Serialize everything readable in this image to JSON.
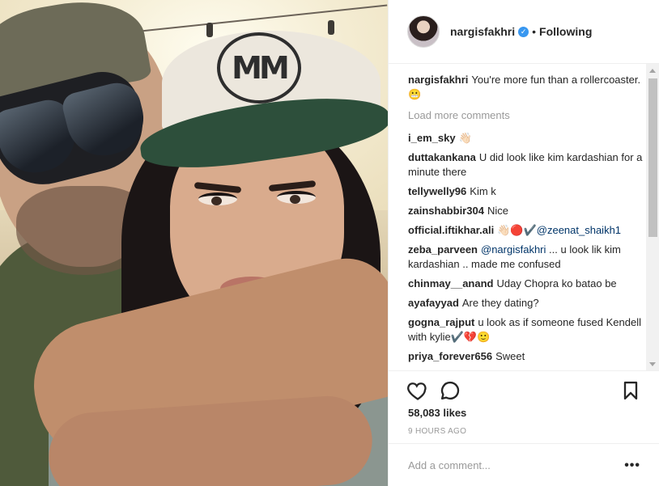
{
  "post": {
    "username": "nargisfakhri",
    "verified": true,
    "follow_separator": "•",
    "follow_status": "Following",
    "caption_user": "nargisfakhri",
    "caption_text": "You're more fun than a rollercoaster. 😬",
    "load_more": "Load more comments",
    "likes": "58,083 likes",
    "time_ago": "9 HOURS AGO",
    "add_comment_placeholder": "Add a comment...",
    "more_label": "•••",
    "photo_cap_logo": "MM"
  },
  "comments": [
    {
      "user": "i_em_sky",
      "text": "👋🏻"
    },
    {
      "user": "duttakankana",
      "text": "U did look like kim kardashian for a minute there"
    },
    {
      "user": "tellywelly96",
      "text": "Kim k"
    },
    {
      "user": "zainshabbir304",
      "text": "Nice"
    },
    {
      "user": "official.iftikhar.ali",
      "text": "👋🏻🔴✔️",
      "mention": "@zeenat_shaikh1"
    },
    {
      "user": "zeba_parveen",
      "mention": "@nargisfakhri",
      "text": "... u look lik kim kardashian .. made me confused"
    },
    {
      "user": "chinmay__anand",
      "text": "Uday Chopra ko batao be"
    },
    {
      "user": "ayafayyad",
      "text": "Are they dating?"
    },
    {
      "user": "gogna_rajput",
      "text": "u look as if someone fused Kendell with kylie✔️💔🙂"
    },
    {
      "user": "priya_forever656",
      "text": "Sweet"
    }
  ],
  "icons": {
    "like": "heart-icon",
    "comment": "comment-icon",
    "save": "bookmark-icon",
    "verified": "verified-badge-icon"
  },
  "colors": {
    "text": "#262626",
    "muted": "#999999",
    "verified": "#3897f0",
    "mention": "#003569",
    "border": "#efefef"
  }
}
